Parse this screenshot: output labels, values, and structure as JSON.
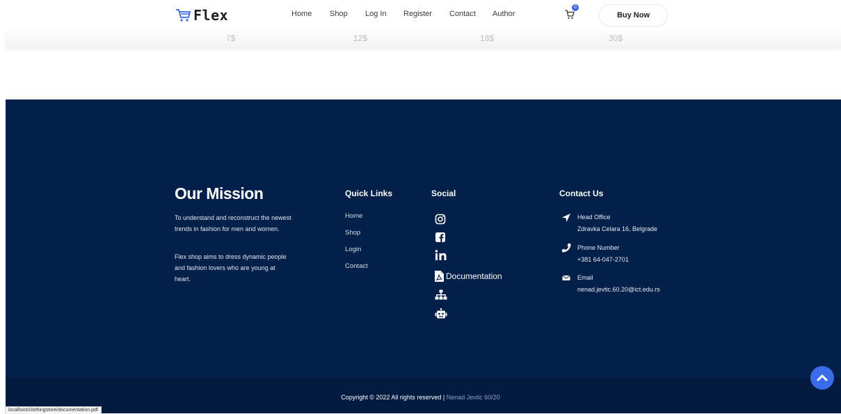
{
  "nav": {
    "logo_text": "Flex",
    "links": [
      "Home",
      "Shop",
      "Log In",
      "Register",
      "Contact",
      "Author"
    ],
    "cart_count": "0",
    "buy_label": "Buy Now"
  },
  "prices": [
    "7$",
    "12$",
    "18$",
    "30$"
  ],
  "footer": {
    "mission": {
      "title": "Our Mission",
      "p1": "To understand and reconstruct the newest trends in fashion for men and women.",
      "p2": "Flex shop aims to dress dynamic people and fashion lovers who are young at heart."
    },
    "quick_links": {
      "title": "Quick Links",
      "items": [
        "Home",
        "Shop",
        "Login",
        "Contact"
      ]
    },
    "social": {
      "title": "Social",
      "documentation_label": "Documentation",
      "icons": [
        "instagram-icon",
        "facebook-icon",
        "linkedin-icon",
        "pdf-icon",
        "sitemap-icon",
        "robot-icon"
      ]
    },
    "contact": {
      "title": "Contact Us",
      "office_label": "Head Office",
      "office_value": "Zdravka Celara 16, Belgrade",
      "phone_label": "Phone Number",
      "phone_value": "+381 64-047-2701",
      "email_label": "Email",
      "email_value": "nenad.jevtic.60.20@ict.edu.rs"
    },
    "copyright_text": "Copyright © 2022 All rights reserved | ",
    "copyright_author": "Nenad Jevtic 60/20"
  },
  "status_url": "localhost/clothingstore/documentation.pdf",
  "colors": {
    "footer_bg": "#03204a",
    "accent": "#3b6be8"
  }
}
